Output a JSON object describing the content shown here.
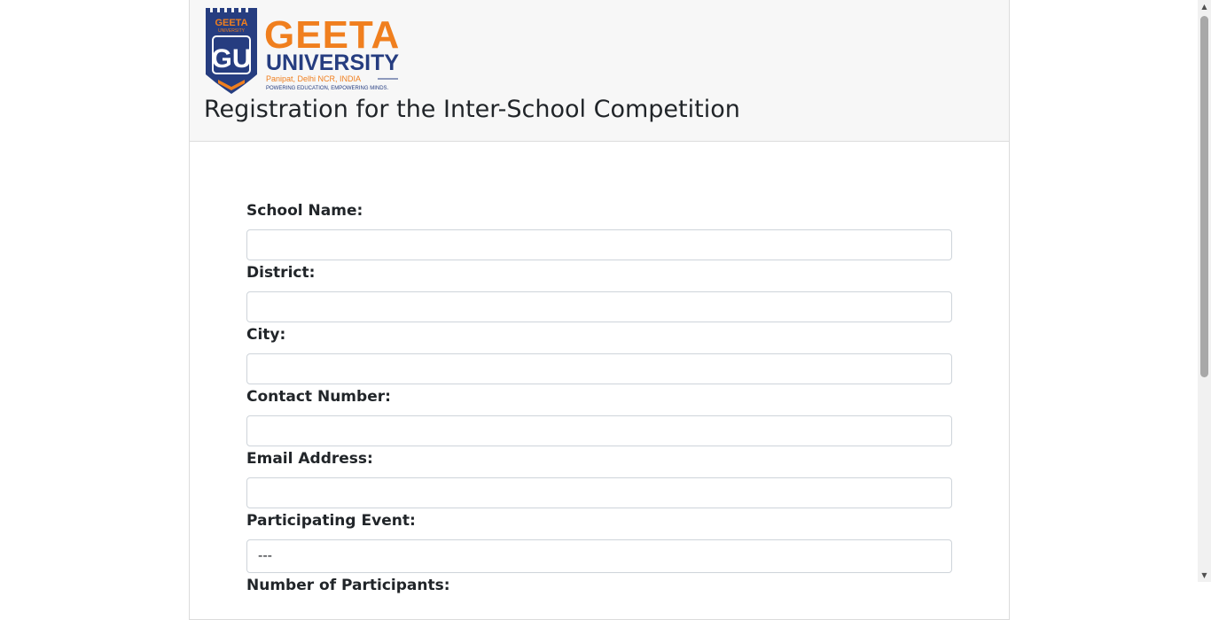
{
  "header": {
    "logo": {
      "line1": "GEETA",
      "line2": "UNIVERSITY",
      "location": "Panipat, Delhi NCR, INDIA",
      "tagline": "POWERING EDUCATION, EMPOWERING MINDS.",
      "shield_top": "GEETA",
      "shield_sub": "UNIVERSITY",
      "shield_mark": "GU",
      "colors": {
        "orange": "#f07f1e",
        "navy": "#263d80"
      }
    },
    "title": "Registration for the Inter-School Competition"
  },
  "form": {
    "fields": [
      {
        "label": "School Name:",
        "value": ""
      },
      {
        "label": "District:",
        "value": ""
      },
      {
        "label": "City:",
        "value": ""
      },
      {
        "label": "Contact Number:",
        "value": ""
      },
      {
        "label": "Email Address:",
        "value": ""
      }
    ],
    "event": {
      "label": "Participating Event:",
      "selected": "---"
    },
    "next_label": "Number of Participants:"
  },
  "scrollbar": {
    "up": "▲",
    "down": "▼"
  }
}
